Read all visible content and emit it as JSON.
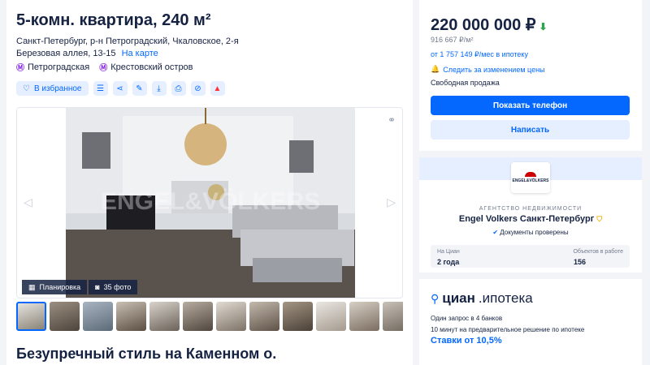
{
  "listing": {
    "title": "5-комн. квартира, 240 м²",
    "address": "Санкт-Петербург, р-н Петроградский, Чкаловское, 2-я Березовая аллея, 13-15",
    "map_link": "На карте",
    "metros": [
      {
        "icon": "metro-icon",
        "name": "Петроградская",
        "color": "#8a2be2"
      },
      {
        "icon": "metro-icon",
        "name": "Крестовский остров",
        "color": "#8a2be2"
      }
    ]
  },
  "actions": {
    "favorite": "В избранное",
    "icons": [
      "compare-icon",
      "share-icon",
      "edit-icon",
      "download-icon",
      "print-icon",
      "hide-icon",
      "report-icon"
    ]
  },
  "gallery": {
    "plan_label": "Планировка",
    "photos_count": "35 фото",
    "watermark": "ENGEL&VÖLKERS",
    "thumbnails": 12
  },
  "description": {
    "title": "Безупречный стиль на Каменном о."
  },
  "price_card": {
    "price": "220 000 000 ₽",
    "price_per_m2": "916 667 ₽/м²",
    "mortgage": "от 1 757 149 ₽/мес в ипотеку",
    "follow": "Следить за изменением цены",
    "sale_type": "Свободная продажа",
    "phone_button": "Показать телефон",
    "write_button": "Написать"
  },
  "agency": {
    "logo_text": "ENGEL&VÖLKERS",
    "label": "АГЕНТСТВО НЕДВИЖИМОСТИ",
    "name": "Engel Volkers Санкт-Петербург",
    "docs": "Документы проверены",
    "stat1_label": "На Циан",
    "stat1_value": "2 года",
    "stat2_label": "Объектов в работе",
    "stat2_value": "156"
  },
  "mortgage_card": {
    "brand": "циан",
    "product": ".ипотека",
    "line1": "Один запрос в 4 банков",
    "line2": "10 минут на предварительное решение по ипотеке",
    "rate": "Ставки от 10,5%"
  },
  "colors": {
    "accent": "#0468ff",
    "text": "#152242",
    "muted": "#737a8e",
    "light_blue": "#e6efff"
  }
}
